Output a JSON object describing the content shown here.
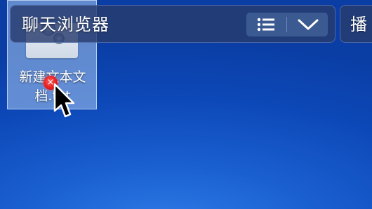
{
  "desktop": {
    "background_color": "#1a5fd0",
    "selected_icon": {
      "label": "新建文本文\n档.txt",
      "icon_name": "text-document-icon",
      "selection_color": "#aac8f0"
    },
    "rename_badge": {
      "glyph": "×",
      "color": "#e21b1b"
    }
  },
  "chat_browser_bar": {
    "title": "聊天浏览器",
    "list_button_icon": "list-icon",
    "dropdown_button_icon": "chevron-down-icon"
  },
  "second_bar": {
    "title": "播"
  }
}
